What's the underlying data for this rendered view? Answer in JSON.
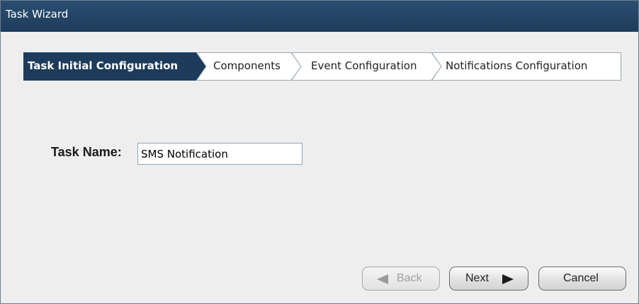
{
  "window": {
    "title": "Task Wizard"
  },
  "steps": [
    {
      "label": "Task Initial Configuration",
      "active": true
    },
    {
      "label": "Components",
      "active": false
    },
    {
      "label": "Event Configuration",
      "active": false
    },
    {
      "label": "Notifications Configuration",
      "active": false
    }
  ],
  "form": {
    "task_name_label": "Task Name:",
    "task_name_value": "SMS Notification"
  },
  "buttons": {
    "back_label": "Back",
    "next_label": "Next",
    "cancel_label": "Cancel"
  },
  "colors": {
    "titlebar": "#1f3f5f",
    "active_step": "#1d3c5c",
    "input_border": "#8aa6c1"
  }
}
